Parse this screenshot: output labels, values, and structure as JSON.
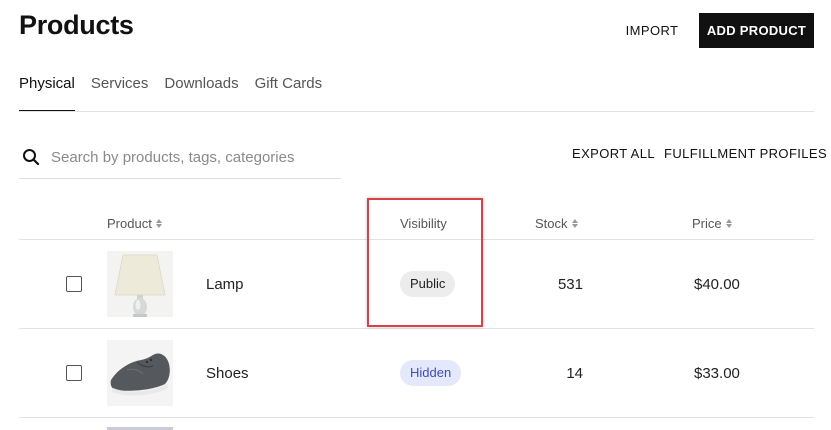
{
  "header": {
    "title": "Products",
    "import_label": "IMPORT",
    "add_label": "ADD PRODUCT"
  },
  "tabs": [
    {
      "label": "Physical",
      "active": true
    },
    {
      "label": "Services",
      "active": false
    },
    {
      "label": "Downloads",
      "active": false
    },
    {
      "label": "Gift Cards",
      "active": false
    }
  ],
  "search": {
    "placeholder": "Search by products, tags, categories",
    "value": ""
  },
  "actions": {
    "export_label": "EXPORT ALL",
    "fulfillment_label": "FULFILLMENT PROFILES"
  },
  "table": {
    "columns": {
      "product": "Product",
      "visibility": "Visibility",
      "stock": "Stock",
      "price": "Price"
    },
    "rows": [
      {
        "name": "Lamp",
        "visibility": "Public",
        "stock": "531",
        "price": "$40.00"
      },
      {
        "name": "Shoes",
        "visibility": "Hidden",
        "stock": "14",
        "price": "$33.00"
      }
    ]
  },
  "colors": {
    "primary_button": "#111111",
    "highlight_border": "#d9414a",
    "hidden_badge_bg": "#e4e8fb",
    "hidden_badge_text": "#3d4fb8",
    "public_badge_bg": "#ececec"
  }
}
